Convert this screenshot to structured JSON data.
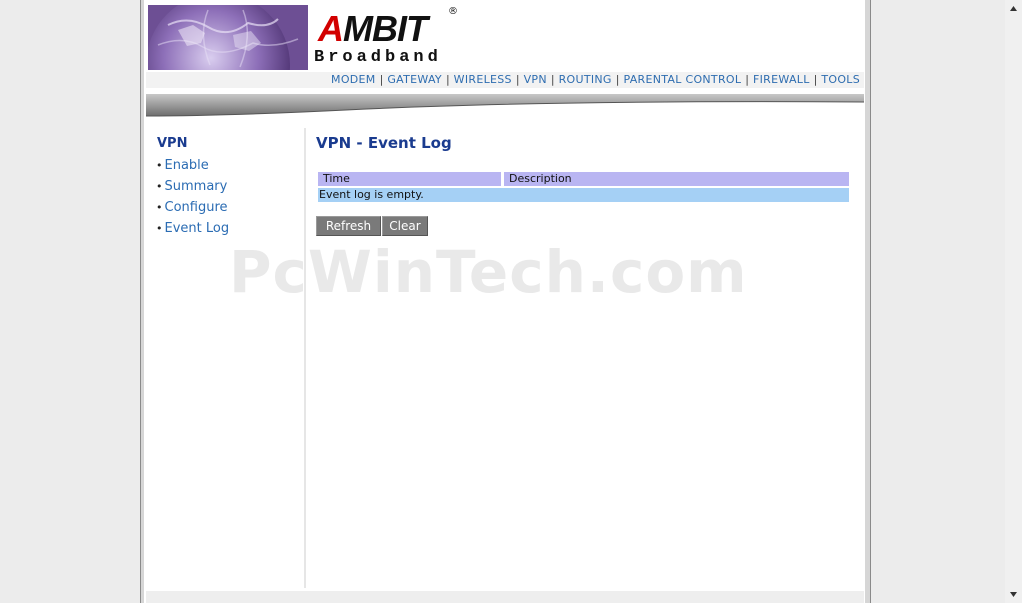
{
  "brand": {
    "name": "AMBIT",
    "registered": "®",
    "subtitle": "Broadband"
  },
  "nav": [
    {
      "label": "MODEM"
    },
    {
      "label": "GATEWAY"
    },
    {
      "label": "WIRELESS"
    },
    {
      "label": "VPN"
    },
    {
      "label": "ROUTING"
    },
    {
      "label": "PARENTAL CONTROL"
    },
    {
      "label": "FIREWALL"
    },
    {
      "label": "TOOLS"
    }
  ],
  "sidebar": {
    "title": "VPN",
    "items": [
      {
        "label": "Enable"
      },
      {
        "label": "Summary"
      },
      {
        "label": "Configure"
      },
      {
        "label": "Event Log"
      }
    ]
  },
  "main": {
    "title": "VPN - Event Log",
    "table": {
      "columns": [
        "Time",
        "Description"
      ],
      "empty_message": "Event log is empty."
    },
    "buttons": {
      "refresh": "Refresh",
      "clear": "Clear"
    }
  },
  "watermark": "PcWinTech.com",
  "colors": {
    "accent": "#1a3b8f",
    "link": "#2b6cb3",
    "table_header": "#b9b5f2",
    "table_row": "#a5d0f5",
    "button": "#7a7a7a"
  }
}
